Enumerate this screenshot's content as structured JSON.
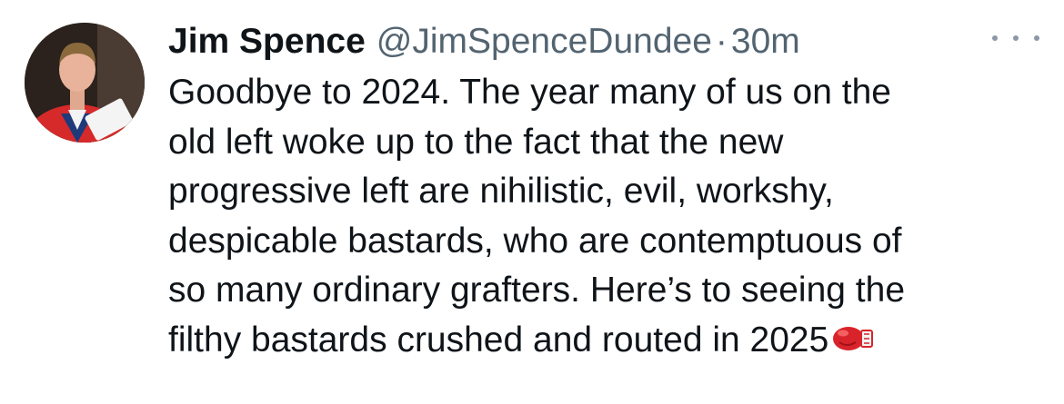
{
  "tweet": {
    "author_name": "Jim Spence",
    "handle": "@JimSpenceDundee",
    "separator": "·",
    "time": "30m",
    "more_icon": "ellipsis-icon",
    "avatar_icon": "profile-avatar",
    "text_lines": [
      "Goodbye to 2024. The year many of us on the",
      "old left woke up to the fact that the new",
      "progressive left are nihilistic, evil, workshy,",
      "despicable bastards, who are contemptuous of",
      "so many ordinary grafters. Here’s to seeing the",
      "filthy bastards crushed and routed in 2025"
    ],
    "trailing_emoji": "boxing-glove-icon"
  },
  "colors": {
    "text": "#0f1419",
    "secondary": "#536471",
    "background": "#ffffff",
    "glove": "#d8232a"
  }
}
